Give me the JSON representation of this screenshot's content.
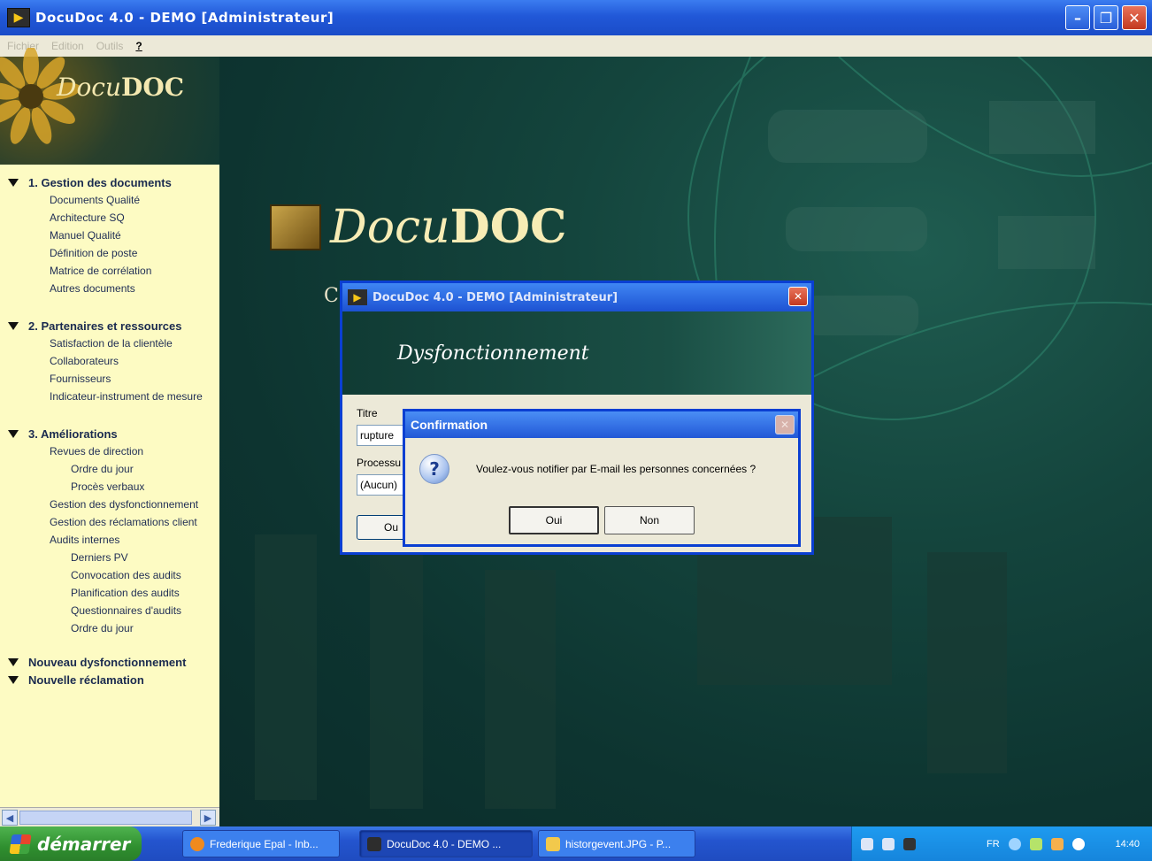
{
  "window": {
    "title": "DocuDoc 4.0 - DEMO [Administrateur]",
    "controls": [
      "minimize",
      "restore",
      "close"
    ]
  },
  "menu": [
    "Fichier",
    "Edition",
    "Outils",
    "?"
  ],
  "sidebar": {
    "logo_italic": "Docu",
    "logo_bold": "DOC",
    "sections": [
      {
        "title": "1. Gestion des documents",
        "items": [
          {
            "label": "Documents Qualité",
            "level": 1
          },
          {
            "label": "Architecture SQ",
            "level": 1
          },
          {
            "label": "Manuel Qualité",
            "level": 1
          },
          {
            "label": "Définition de poste",
            "level": 1
          },
          {
            "label": "Matrice de corrélation",
            "level": 1
          },
          {
            "label": "Autres documents",
            "level": 1
          }
        ]
      },
      {
        "title": "2. Partenaires et ressources",
        "items": [
          {
            "label": "Satisfaction de la clientèle",
            "level": 1
          },
          {
            "label": "Collaborateurs",
            "level": 1
          },
          {
            "label": "Fournisseurs",
            "level": 1
          },
          {
            "label": "Indicateur-instrument de mesure",
            "level": 1
          }
        ]
      },
      {
        "title": "3. Améliorations",
        "items": [
          {
            "label": "Revues de direction",
            "level": 1
          },
          {
            "label": "Ordre du jour",
            "level": 2
          },
          {
            "label": "Procès verbaux",
            "level": 2
          },
          {
            "label": "Gestion des dysfonctionnement",
            "level": 1
          },
          {
            "label": "Gestion des réclamations client",
            "level": 1
          },
          {
            "label": "Audits internes",
            "level": 1
          },
          {
            "label": "Derniers PV",
            "level": 2
          },
          {
            "label": "Convocation des audits",
            "level": 2
          },
          {
            "label": "Planification des audits",
            "level": 2
          },
          {
            "label": "Questionnaires d'audits",
            "level": 2
          },
          {
            "label": "Ordre du jour",
            "level": 2
          }
        ]
      }
    ],
    "actions": [
      "Nouveau dysfonctionnement",
      "Nouvelle réclamation"
    ]
  },
  "main": {
    "logo_italic": "Docu",
    "logo_bold": "DOC",
    "partial_text": "C"
  },
  "dialog": {
    "title": "DocuDoc 4.0 - DEMO [Administrateur]",
    "banner": "Dysfonctionnement",
    "titre_label": "Titre",
    "titre_value": "rupture",
    "processus_label": "Processu",
    "processus_value": "(Aucun)",
    "button_partial": "Ou"
  },
  "confirm": {
    "title": "Confirmation",
    "message": "Voulez-vous notifier par E-mail les personnes concernées ?",
    "yes": "Oui",
    "no": "Non"
  },
  "taskbar": {
    "start": "démarrer",
    "tasks": [
      {
        "label": "Frederique Epal - Inb...",
        "color": "#f08a1e",
        "active": false
      },
      {
        "label": "DocuDoc 4.0 - DEMO ...",
        "color": "#2d2d2d",
        "active": true
      },
      {
        "label": "historgevent.JPG - P...",
        "color": "#f2c94c",
        "active": false
      }
    ],
    "language": "FR",
    "clock": "14:40"
  }
}
